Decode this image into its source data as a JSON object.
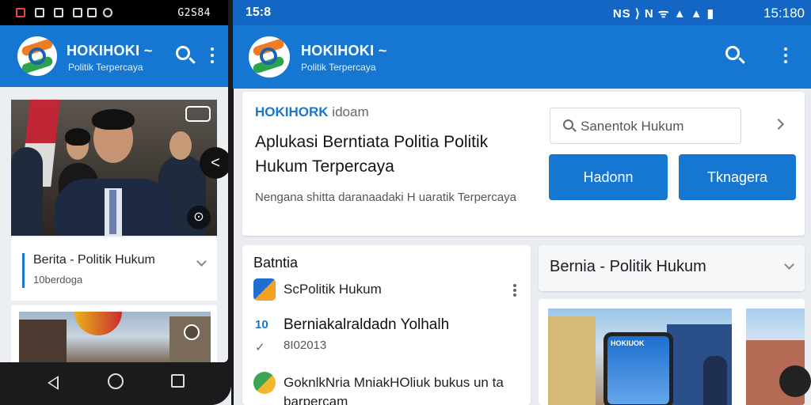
{
  "phone": {
    "status_clock": "G2S84",
    "brand": "HOKIHOKI ~",
    "tagline": "Politik Terpercaya",
    "card_title": "Berita - Politik Hukum",
    "card_subtitle": "10berdoga"
  },
  "tablet": {
    "status_time_left": "15:8",
    "status_icons": "NS ⟩ N ᯤ ▲ ▲ ▮",
    "status_clock": "15:180",
    "brand": "HOKIHOKI ~",
    "tagline": "Politik Terpercaya",
    "hero": {
      "brand_bold": "HOKIHORK",
      "brand_rest": "idoam",
      "headline": "Aplukasi Berntiata Politia Politik Hukum Terpercaya",
      "description": "Nengana shitta daranaadaki H uaratik Terpercaya",
      "search_placeholder": "Sanentok Hukum",
      "button_left": "Hadonn",
      "button_right": "Tknagera"
    },
    "list": {
      "title": "Batntia",
      "row1": "ScPolitik Hukum",
      "row2_mark": "10",
      "row2": "Berniakalraldadn Yolhalh",
      "row2_mark_sub": "✓",
      "row2_sub": "8I02013",
      "row3": "GoknlkNria MniakHOliuk bukus un ta barpercam"
    },
    "news_title": "Bernia - Politik Hukum",
    "phone_screen_label": "HOKIUOK"
  }
}
